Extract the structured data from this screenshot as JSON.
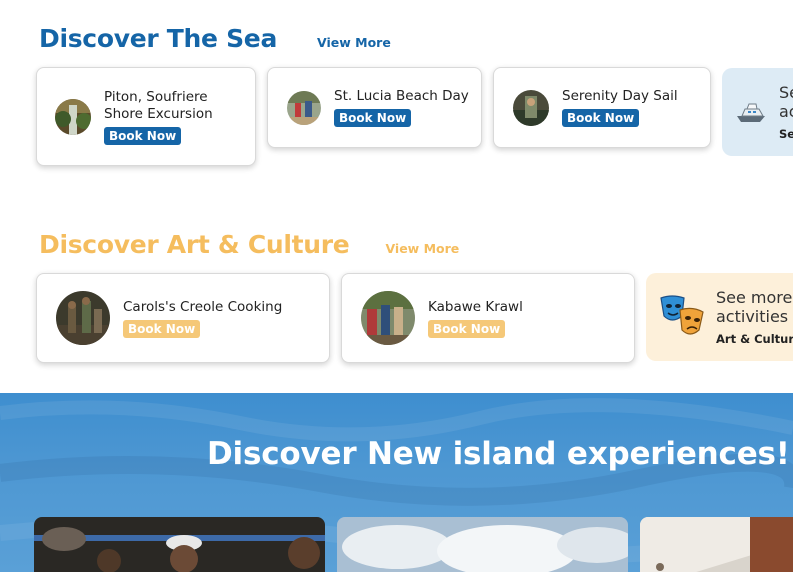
{
  "sea": {
    "title": "Discover The Sea",
    "view_more": "View More",
    "cards": [
      {
        "title_line1": "Piton, Soufriere",
        "title_line2": "Shore Excursion",
        "book": "Book Now"
      },
      {
        "title_line1": "St. Lucia Beach Day",
        "book": "Book Now"
      },
      {
        "title_line1": "Serenity Day Sail",
        "book": "Book Now"
      }
    ],
    "more": {
      "line1": "Se",
      "line2": "ac",
      "category": "Se"
    }
  },
  "art": {
    "title": "Discover Art & Culture",
    "view_more": "View More",
    "cards": [
      {
        "title_line1": "Carols's Creole Cooking",
        "book": "Book Now"
      },
      {
        "title_line1": "Kabawe Krawl",
        "book": "Book Now"
      }
    ],
    "more": {
      "line1": "See more",
      "line2": "activities",
      "category": "Art & Culture"
    }
  },
  "banner": {
    "title": "Discover New island experiences!"
  },
  "colors": {
    "sea_blue": "#1565a7",
    "art_gold": "#f5bd5e",
    "banner_blue": "#4d97d2"
  }
}
